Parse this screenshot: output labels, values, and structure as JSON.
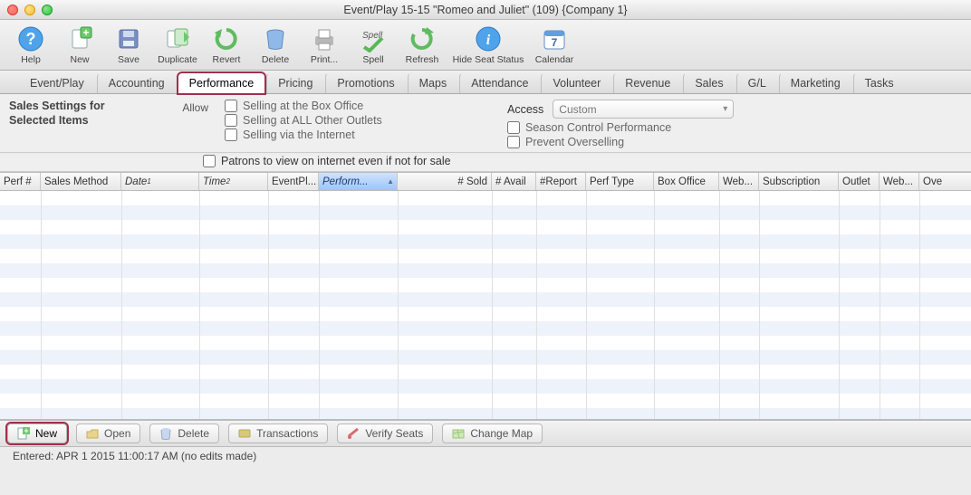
{
  "window": {
    "title": "Event/Play 15-15 \"Romeo and Juliet\" (109) {Company 1}"
  },
  "toolbar": {
    "help": "Help",
    "new": "New",
    "save": "Save",
    "duplicate": "Duplicate",
    "revert": "Revert",
    "delete": "Delete",
    "print": "Print...",
    "spell": "Spell",
    "refresh": "Refresh",
    "hide_seat_status": "Hide Seat Status",
    "calendar": "Calendar"
  },
  "tabs": {
    "event_play": "Event/Play",
    "accounting": "Accounting",
    "performance": "Performance",
    "pricing": "Pricing",
    "promotions": "Promotions",
    "maps": "Maps",
    "attendance": "Attendance",
    "volunteer": "Volunteer",
    "revenue": "Revenue",
    "sales": "Sales",
    "gl": "G/L",
    "marketing": "Marketing",
    "tasks": "Tasks"
  },
  "settings": {
    "heading": "Sales Settings for Selected Items",
    "allow_label": "Allow",
    "allow": {
      "box_office": "Selling at the Box Office",
      "all_outlets": "Selling at ALL Other Outlets",
      "internet": "Selling via the Internet",
      "patrons_view": "Patrons to view on internet even if not for sale"
    },
    "access_label": "Access",
    "access_value": "Custom",
    "season_control": "Season Control Performance",
    "prevent_overselling": "Prevent Overselling"
  },
  "grid": {
    "columns": {
      "perf_no": "Perf #",
      "sales_method": "Sales Method",
      "date": "Date",
      "time": "Time",
      "event_pl": "EventPl...",
      "perform": "Perform...",
      "sold": "# Sold",
      "avail": "# Avail",
      "report": "#Report",
      "perf_type": "Perf Type",
      "box_office": "Box Office",
      "web": "Web...",
      "subscription": "Subscription",
      "outlet": "Outlet",
      "web2": "Web...",
      "ove": "Ove"
    }
  },
  "footer": {
    "new": "New",
    "open": "Open",
    "delete": "Delete",
    "transactions": "Transactions",
    "verify_seats": "Verify Seats",
    "change_map": "Change Map"
  },
  "status": {
    "text": "Entered: APR 1 2015 11:00:17 AM (no edits made)"
  }
}
